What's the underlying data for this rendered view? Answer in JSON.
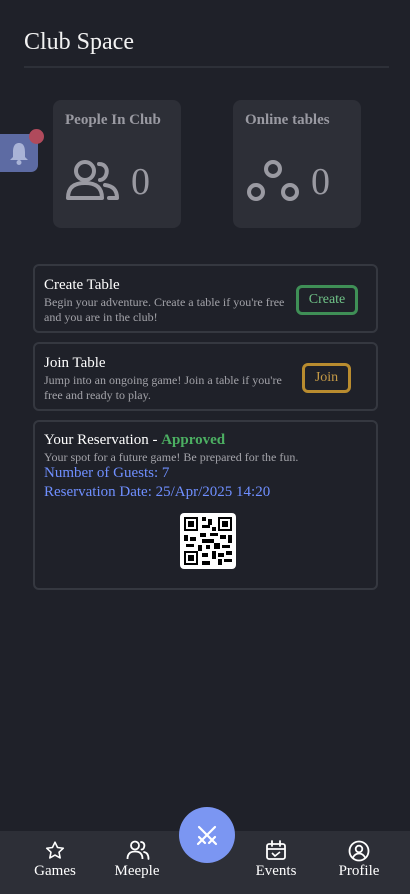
{
  "header": {
    "title": "Club Space"
  },
  "notifications": {
    "icon": "bell-icon"
  },
  "stats": [
    {
      "label": "People In Club",
      "value": "0",
      "icon": "people-icon"
    },
    {
      "label": "Online tables",
      "value": "0",
      "icon": "tables-icon"
    }
  ],
  "create_table": {
    "title": "Create Table",
    "description": "Begin your adventure. Create a table if you're free and you are in the club!",
    "button": "Create"
  },
  "join_table": {
    "title": "Join Table",
    "description": "Jump into an ongoing game! Join a table if you're free and ready to play.",
    "button": "Join"
  },
  "reservation": {
    "title_prefix": "Your Reservation - ",
    "status": "Approved",
    "description": "Your spot for a future game! Be prepared for the fun.",
    "guests": "Number of Guests: 7",
    "date": "Reservation Date: 25/Apr/2025 14:20"
  },
  "bottom_nav": {
    "games": "Games",
    "meeple": "Meeple",
    "events": "Events",
    "profile": "Profile"
  },
  "colors": {
    "background": "#1f2129",
    "card": "#2d2f37",
    "accent": "#7b96f2",
    "approved": "#4caf62",
    "link": "#6f8fff",
    "create": "#3f8f56",
    "join": "#b98c2f"
  }
}
